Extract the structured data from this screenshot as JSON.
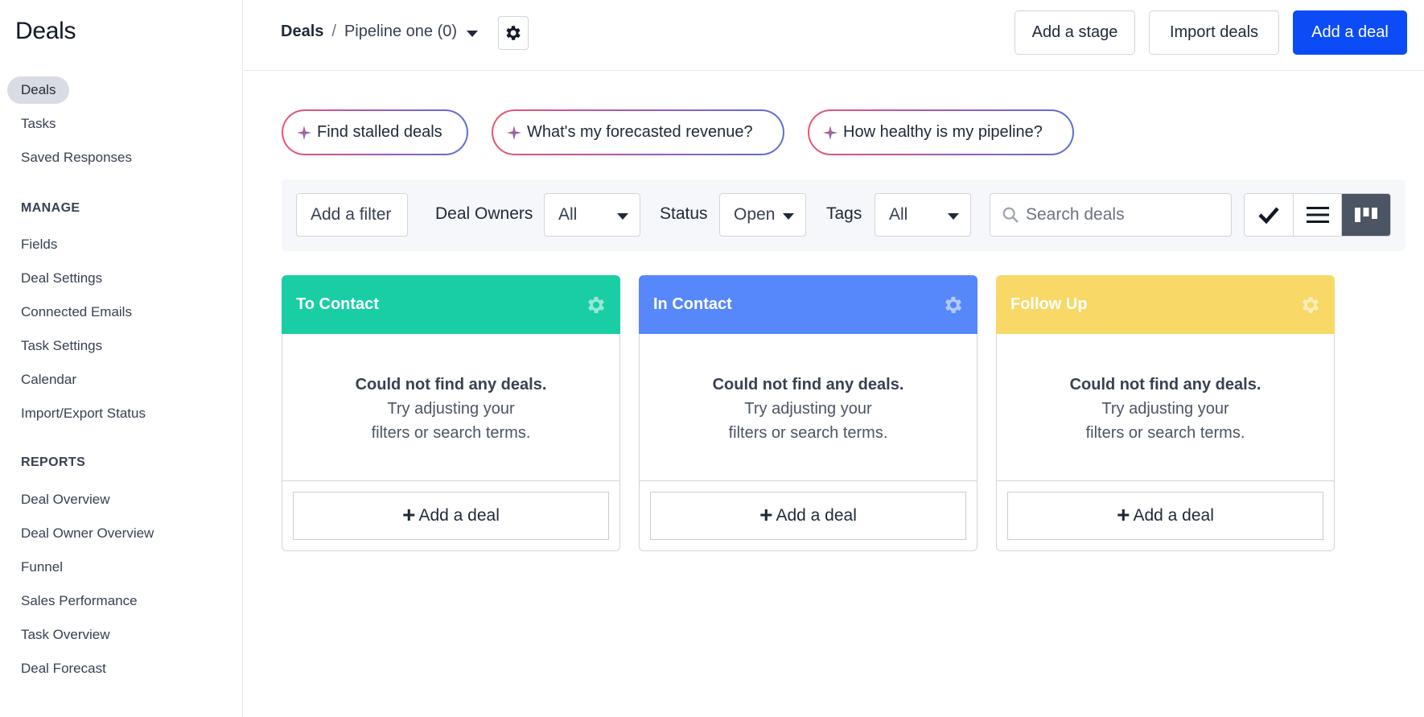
{
  "sidebar": {
    "title": "Deals",
    "items_top": [
      {
        "label": "Deals",
        "active": true
      },
      {
        "label": "Tasks"
      },
      {
        "label": "Saved Responses"
      }
    ],
    "manage_heading": "MANAGE",
    "manage_items": [
      "Fields",
      "Deal Settings",
      "Connected Emails",
      "Task Settings",
      "Calendar",
      "Import/Export Status"
    ],
    "reports_heading": "REPORTS",
    "report_items": [
      "Deal Overview",
      "Deal Owner Overview",
      "Funnel",
      "Sales Performance",
      "Task Overview",
      "Deal Forecast"
    ]
  },
  "header": {
    "breadcrumb_root": "Deals",
    "breadcrumb_sep": "/",
    "pipeline": "Pipeline one (0)",
    "add_stage": "Add a stage",
    "import_deals": "Import deals",
    "add_deal": "Add a deal"
  },
  "ai_prompts": [
    "Find stalled deals",
    "What's my forecasted revenue?",
    "How healthy is my pipeline?"
  ],
  "filters": {
    "add_filter": "Add a filter",
    "owners_label": "Deal Owners",
    "owners_value": "All",
    "status_label": "Status",
    "status_value": "Open",
    "tags_label": "Tags",
    "tags_value": "All",
    "search_placeholder": "Search deals"
  },
  "stages": [
    {
      "name": "To Contact",
      "color": "#19cda5"
    },
    {
      "name": "In Contact",
      "color": "#5688fb"
    },
    {
      "name": "Follow Up",
      "color": "#f8d866"
    }
  ],
  "empty": {
    "title": "Could not find any deals.",
    "line1": "Try adjusting your",
    "line2": "filters or search terms."
  },
  "add_deal_label": "Add a deal",
  "colors": {
    "primary": "#0b4cf6"
  }
}
